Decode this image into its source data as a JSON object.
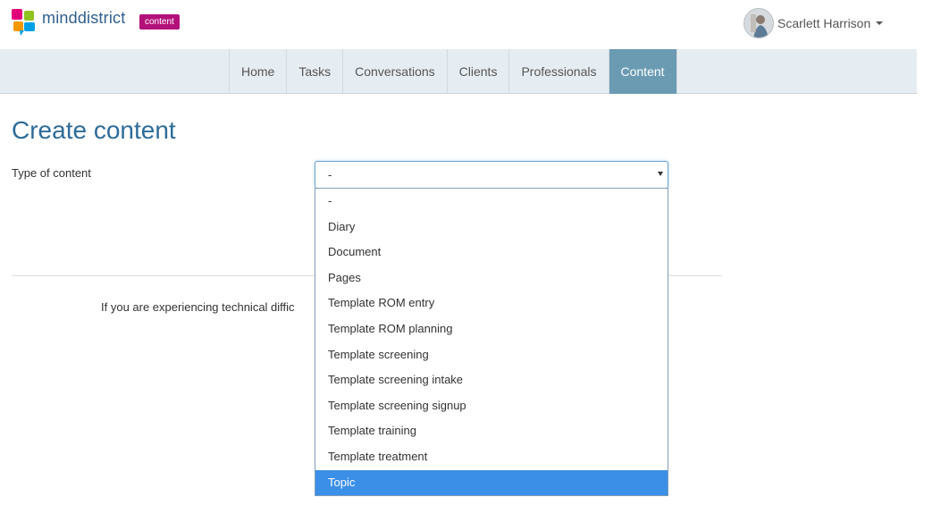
{
  "brand": {
    "name": "minddistrict",
    "badge": "content",
    "badge_color": "#b3117a",
    "text_color": "#2f5f8c"
  },
  "user": {
    "name": "Scarlett Harrison",
    "avatar_icon": "user-avatar-photo"
  },
  "nav": {
    "items": [
      {
        "label": "Home"
      },
      {
        "label": "Tasks"
      },
      {
        "label": "Conversations"
      },
      {
        "label": "Clients"
      },
      {
        "label": "Professionals"
      },
      {
        "label": "Content"
      }
    ],
    "active": "Content",
    "active_color": "#6a9bb3"
  },
  "page": {
    "title": "Create content",
    "field_label": "Type of content",
    "select_value": "-",
    "footer_text": "If you are experiencing technical diffic"
  },
  "dropdown": {
    "options": [
      "-",
      "Diary",
      "Document",
      "Pages",
      "Template ROM entry",
      "Template ROM planning",
      "Template screening",
      "Template screening intake",
      "Template screening signup",
      "Template training",
      "Template treatment",
      "Topic"
    ],
    "highlighted": "Topic",
    "highlight_color": "#3b8fe6"
  }
}
